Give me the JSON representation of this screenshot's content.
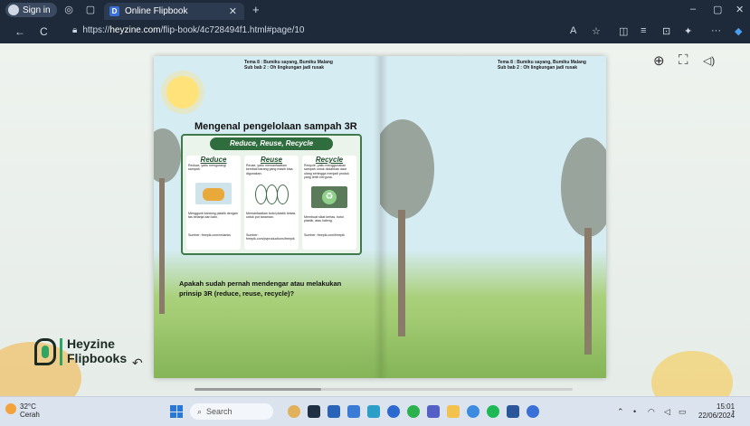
{
  "browser": {
    "signin_label": "Sign in",
    "tab_title": "Online Flipbook",
    "tab_favicon": "D",
    "new_tab": "+",
    "url_scheme": "https://",
    "url_host": "heyzine.com",
    "url_path": "/flip-book/4c728494f1.html#page/10",
    "win_min": "–",
    "win_max": "▢",
    "win_close": "✕",
    "nav_back": "←",
    "nav_reload": "C"
  },
  "viewer": {
    "zoom_icon": "⊕",
    "fullscreen_icon": "⛶",
    "sound_icon": "◁)",
    "logo_line1": "Heyzine",
    "logo_line2": "Flipbooks",
    "share_icon": "↶"
  },
  "left_page": {
    "header_line1": "Tema 8 : Bumiku sayang, Bumiku Malang",
    "header_line2": "Sub bab 2 : Oh lingkungan jadi rusak",
    "title": "Mengenal pengelolaan sampah 3R",
    "banner": "Reduce, Reuse, Recycle",
    "columns": [
      {
        "heading": "Reduce",
        "desc": "Reduce, yaitu mengurangi sampah.",
        "caption": "Menggunti kantong plastik dengan tas belanja dari kain.",
        "source": "Sumber: freepik.com/redanks"
      },
      {
        "heading": "Reuse",
        "desc": "Reuse, yaitu memanfaatkan kembali barang yang masih bisa digunakan.",
        "caption": "Memanfaatkan botol plastik bekas untuk pot tanaman.",
        "source": "Sumber: freepik.com/pvproductions/freepik"
      },
      {
        "heading": "Recycle",
        "desc": "Recycle, yaitu menggunakan sampah untuk diolahkan daur ulang sehingga menjadi produk yang lebih berguna.",
        "caption": "Membuat sikat kertas, botol plastik, atau kaleng.",
        "source": "Sumber: freepik.com/freepik"
      }
    ],
    "question_line1": "Apakah sudah pernah mendengar atau melakukan",
    "question_line2": "prinsip 3R (reduce, reuse, recycle)?"
  },
  "right_page": {
    "header_line1": "Tema 8 : Bumiku sayang, Bumiku Malang",
    "header_line2": "Sub bab 2 : Oh lingkungan jadi rusak"
  },
  "taskbar": {
    "temp": "32°C",
    "weather": "Cerah",
    "search_label": "Search",
    "time": "15:01",
    "date": "22/06/2024"
  }
}
